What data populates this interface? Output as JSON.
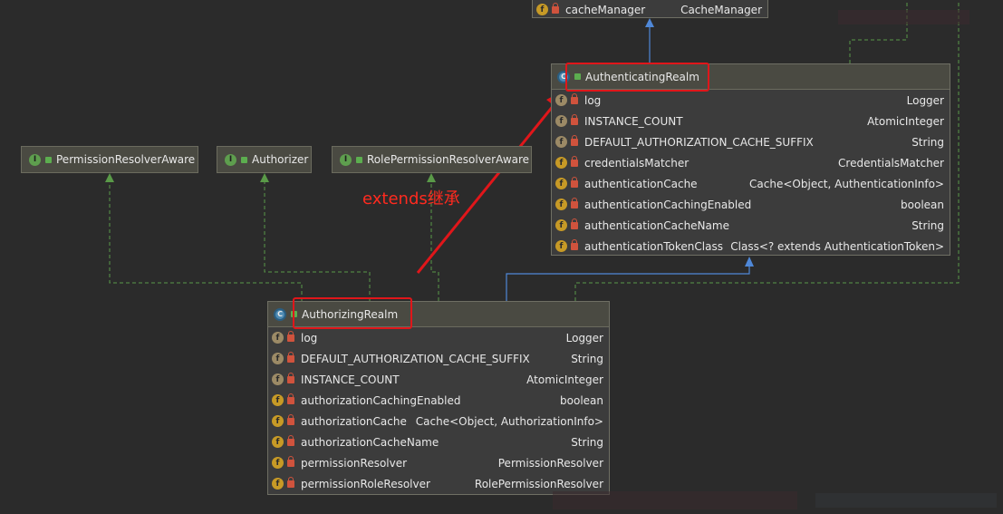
{
  "colors": {
    "background": "#2b2b2b",
    "annotation_red": "#e0161a",
    "inherit_arrow": "#4f88d8",
    "implements_arrow": "#5a9a48"
  },
  "top_field": {
    "name": "cacheManager",
    "type": "CacheManager"
  },
  "interfaces": [
    {
      "label": "PermissionResolverAware"
    },
    {
      "label": "Authorizer"
    },
    {
      "label": "RolePermissionResolverAware"
    }
  ],
  "authenticating_realm": {
    "title": "AuthenticatingRealm",
    "fields": [
      {
        "name": "log",
        "type": "Logger"
      },
      {
        "name": "INSTANCE_COUNT",
        "type": "AtomicInteger"
      },
      {
        "name": "DEFAULT_AUTHORIZATION_CACHE_SUFFIX",
        "type": "String"
      },
      {
        "name": "credentialsMatcher",
        "type": "CredentialsMatcher"
      },
      {
        "name": "authenticationCache",
        "type": "Cache<Object, AuthenticationInfo>"
      },
      {
        "name": "authenticationCachingEnabled",
        "type": "boolean"
      },
      {
        "name": "authenticationCacheName",
        "type": "String"
      },
      {
        "name": "authenticationTokenClass",
        "type": "Class<? extends AuthenticationToken>"
      }
    ]
  },
  "authorizing_realm": {
    "title": "AuthorizingRealm",
    "fields": [
      {
        "name": "log",
        "type": "Logger"
      },
      {
        "name": "DEFAULT_AUTHORIZATION_CACHE_SUFFIX",
        "type": "String"
      },
      {
        "name": "INSTANCE_COUNT",
        "type": "AtomicInteger"
      },
      {
        "name": "authorizationCachingEnabled",
        "type": "boolean"
      },
      {
        "name": "authorizationCache",
        "type": "Cache<Object, AuthorizationInfo>"
      },
      {
        "name": "authorizationCacheName",
        "type": "String"
      },
      {
        "name": "permissionResolver",
        "type": "PermissionResolver"
      },
      {
        "name": "permissionRoleResolver",
        "type": "RolePermissionResolver"
      }
    ]
  },
  "annotation": "extends继承",
  "icon_letters": {
    "field": "f",
    "interface": "I",
    "class": "C"
  }
}
